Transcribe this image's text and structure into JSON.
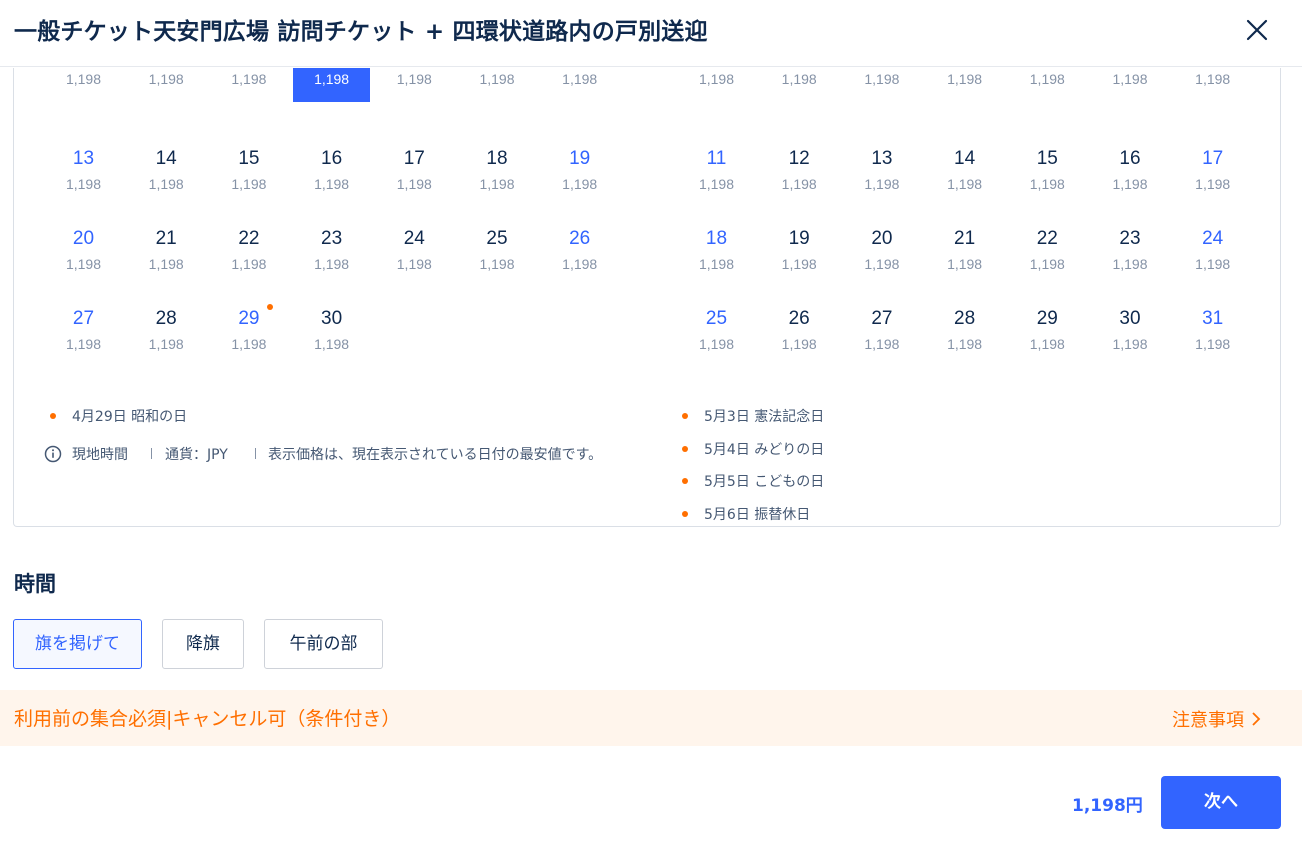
{
  "header": {
    "title": "一般チケット天安門広場 訪問チケット + 四環状道路内の戸別送迎"
  },
  "calendar": {
    "months": [
      {
        "weeks": [
          [
            {
              "day": "",
              "price": "1,198",
              "weekend": false
            },
            {
              "day": "",
              "price": "1,198",
              "weekend": false
            },
            {
              "day": "",
              "price": "1,198",
              "weekend": false
            },
            {
              "day": "",
              "price": "1,198",
              "weekend": false,
              "selected": true
            },
            {
              "day": "",
              "price": "1,198",
              "weekend": false
            },
            {
              "day": "",
              "price": "1,198",
              "weekend": false
            },
            {
              "day": "",
              "price": "1,198",
              "weekend": false
            }
          ],
          [
            {
              "day": "13",
              "price": "1,198",
              "weekend": true
            },
            {
              "day": "14",
              "price": "1,198",
              "weekend": false
            },
            {
              "day": "15",
              "price": "1,198",
              "weekend": false
            },
            {
              "day": "16",
              "price": "1,198",
              "weekend": false
            },
            {
              "day": "17",
              "price": "1,198",
              "weekend": false
            },
            {
              "day": "18",
              "price": "1,198",
              "weekend": false
            },
            {
              "day": "19",
              "price": "1,198",
              "weekend": true
            }
          ],
          [
            {
              "day": "20",
              "price": "1,198",
              "weekend": true
            },
            {
              "day": "21",
              "price": "1,198",
              "weekend": false
            },
            {
              "day": "22",
              "price": "1,198",
              "weekend": false
            },
            {
              "day": "23",
              "price": "1,198",
              "weekend": false
            },
            {
              "day": "24",
              "price": "1,198",
              "weekend": false
            },
            {
              "day": "25",
              "price": "1,198",
              "weekend": false
            },
            {
              "day": "26",
              "price": "1,198",
              "weekend": true
            }
          ],
          [
            {
              "day": "27",
              "price": "1,198",
              "weekend": true
            },
            {
              "day": "28",
              "price": "1,198",
              "weekend": false
            },
            {
              "day": "29",
              "price": "1,198",
              "weekend": true,
              "holiday": true
            },
            {
              "day": "30",
              "price": "1,198",
              "weekend": false
            }
          ]
        ],
        "holidays": [
          "4月29日 昭和の日"
        ]
      },
      {
        "weeks": [
          [
            {
              "day": "",
              "price": "1,198",
              "weekend": false
            },
            {
              "day": "",
              "price": "1,198",
              "weekend": false
            },
            {
              "day": "",
              "price": "1,198",
              "weekend": false
            },
            {
              "day": "",
              "price": "1,198",
              "weekend": false
            },
            {
              "day": "",
              "price": "1,198",
              "weekend": false
            },
            {
              "day": "",
              "price": "1,198",
              "weekend": false
            },
            {
              "day": "",
              "price": "1,198",
              "weekend": false
            }
          ],
          [
            {
              "day": "11",
              "price": "1,198",
              "weekend": true
            },
            {
              "day": "12",
              "price": "1,198",
              "weekend": false
            },
            {
              "day": "13",
              "price": "1,198",
              "weekend": false
            },
            {
              "day": "14",
              "price": "1,198",
              "weekend": false
            },
            {
              "day": "15",
              "price": "1,198",
              "weekend": false
            },
            {
              "day": "16",
              "price": "1,198",
              "weekend": false
            },
            {
              "day": "17",
              "price": "1,198",
              "weekend": true
            }
          ],
          [
            {
              "day": "18",
              "price": "1,198",
              "weekend": true
            },
            {
              "day": "19",
              "price": "1,198",
              "weekend": false
            },
            {
              "day": "20",
              "price": "1,198",
              "weekend": false
            },
            {
              "day": "21",
              "price": "1,198",
              "weekend": false
            },
            {
              "day": "22",
              "price": "1,198",
              "weekend": false
            },
            {
              "day": "23",
              "price": "1,198",
              "weekend": false
            },
            {
              "day": "24",
              "price": "1,198",
              "weekend": true
            }
          ],
          [
            {
              "day": "25",
              "price": "1,198",
              "weekend": true
            },
            {
              "day": "26",
              "price": "1,198",
              "weekend": false
            },
            {
              "day": "27",
              "price": "1,198",
              "weekend": false
            },
            {
              "day": "28",
              "price": "1,198",
              "weekend": false
            },
            {
              "day": "29",
              "price": "1,198",
              "weekend": false
            },
            {
              "day": "30",
              "price": "1,198",
              "weekend": false
            },
            {
              "day": "31",
              "price": "1,198",
              "weekend": true
            }
          ]
        ],
        "holidays": [
          "5月3日 憲法記念日",
          "5月4日 みどりの日",
          "5月5日 こどもの日",
          "5月6日 振替休日"
        ]
      }
    ],
    "note": {
      "local_time": "現地時間",
      "currency": "通貨：JPY",
      "price_note": "表示価格は、現在表示されている日付の最安値です。"
    }
  },
  "time_section": {
    "title": "時間",
    "options": [
      "旗を掲げて",
      "降旗",
      "午前の部"
    ],
    "selected_index": 0
  },
  "notice": {
    "text": "利用前の集合必須|キャンセル可（条件付き）",
    "link": "注意事項"
  },
  "footer": {
    "price": "1,198円",
    "next_button": "次へ"
  },
  "colors": {
    "accent": "#3264ff",
    "holiday_dot": "#ff6f00",
    "notice_bg": "#fff5ec",
    "text": "#0f294d"
  }
}
